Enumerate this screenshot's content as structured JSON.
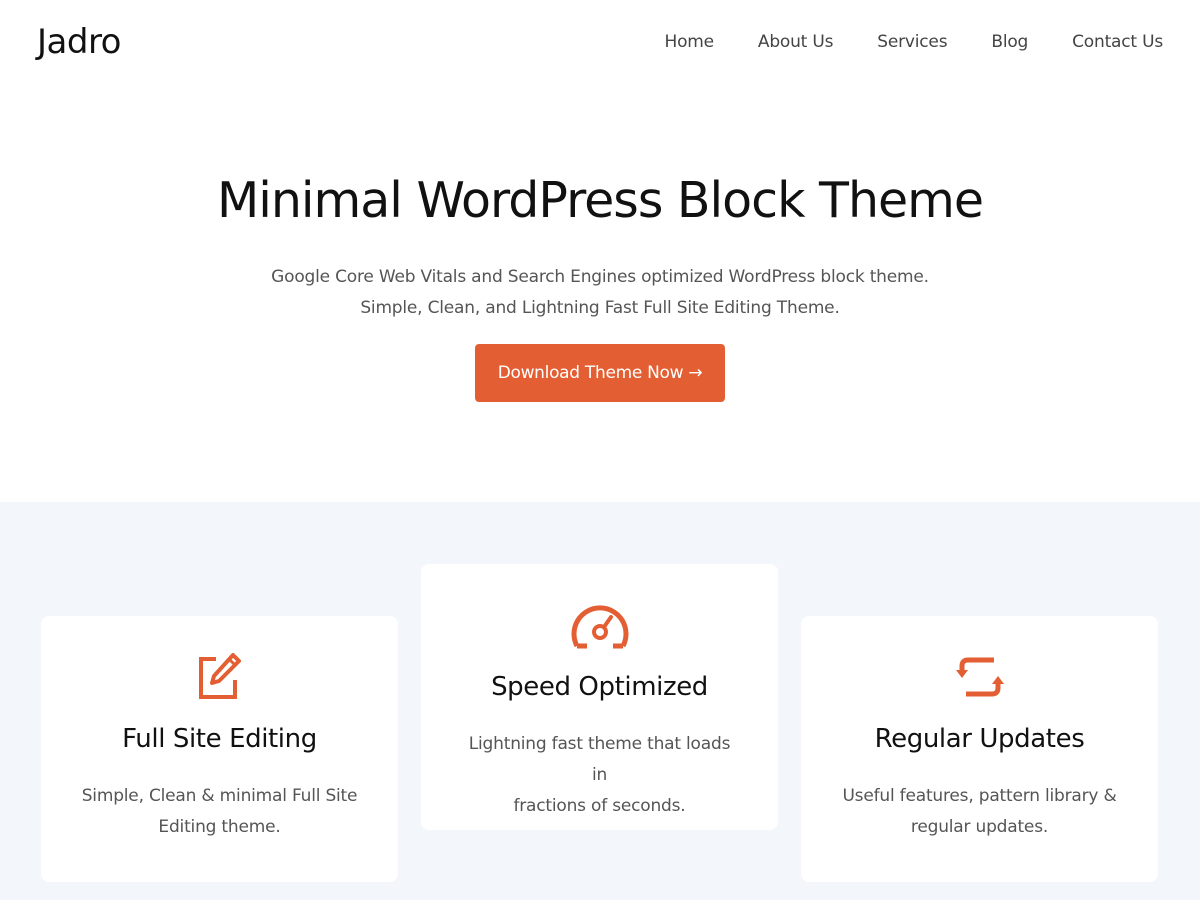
{
  "header": {
    "site_title": "Jadro",
    "nav": [
      "Home",
      "About Us",
      "Services",
      "Blog",
      "Contact Us"
    ]
  },
  "hero": {
    "title": "Minimal WordPress Block Theme",
    "subtitle_line1": "Google Core Web Vitals and Search Engines optimized WordPress block theme.",
    "subtitle_line2": "Simple, Clean, and Lightning Fast Full Site Editing Theme.",
    "cta_label": "Download Theme Now →"
  },
  "features": [
    {
      "icon": "edit-icon",
      "title": "Full Site Editing",
      "desc_line1": "Simple, Clean & minimal Full Site",
      "desc_line2": "Editing theme."
    },
    {
      "icon": "speedometer-icon",
      "title": "Speed Optimized",
      "desc_line1": "Lightning fast theme that loads in",
      "desc_line2": "fractions of seconds."
    },
    {
      "icon": "refresh-icon",
      "title": "Regular Updates",
      "desc_line1": "Useful features, pattern library &",
      "desc_line2": "regular updates."
    }
  ],
  "colors": {
    "accent": "#e35f33",
    "features_bg": "#f3f6fb",
    "text_dark": "#111111",
    "text_muted": "#555555"
  }
}
